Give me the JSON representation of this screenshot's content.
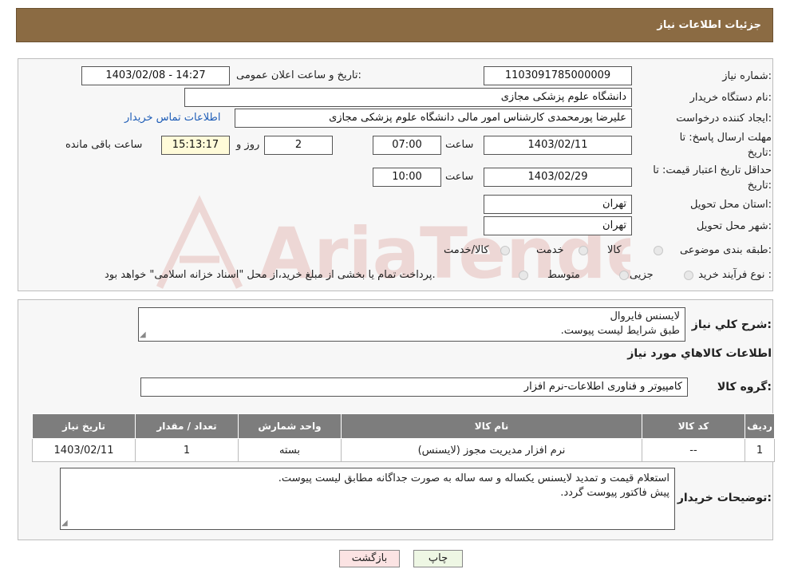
{
  "header": {
    "title": "جزئیات اطلاعات نیاز"
  },
  "form": {
    "need_number_label": "شماره نیاز:",
    "need_number": "1103091785000009",
    "announce_label": "تاریخ و ساعت اعلان عمومی:",
    "announce_value": "1403/02/08 - 14:27",
    "buyer_org_label": "نام دستگاه خریدار:",
    "buyer_org": "دانشگاه علوم پزشکی مجازی",
    "creator_label": "ایجاد کننده درخواست:",
    "creator": "علیرضا پورمحمدی کارشناس امور مالی دانشگاه علوم پزشکی مجازی",
    "contact_link": "اطلاعات تماس خریدار",
    "deadline_label_1": "مهلت ارسال پاسخ: تا",
    "deadline_label_2": "تاریخ:",
    "deadline_date": "1403/02/11",
    "time_label": "ساعت",
    "deadline_time": "07:00",
    "days": "2",
    "days_label": "روز و",
    "remaining_time": "15:13:17",
    "remaining_label": "ساعت باقی مانده",
    "validity_label_1": "حداقل تاریخ اعتبار قیمت: تا",
    "validity_label_2": "تاریخ:",
    "validity_date": "1403/02/29",
    "validity_time": "10:00",
    "province_label": "استان محل تحویل:",
    "province": "تهران",
    "city_label": "شهر محل تحویل:",
    "city": "تهران",
    "category_label": "طبقه بندی موضوعی:",
    "category_options": [
      "کالا",
      "خدمت",
      "کالا/خدمت"
    ],
    "process_label": "نوع فرآیند خرید :",
    "process_options": [
      "جزیی",
      "متوسط"
    ],
    "process_note": "پرداخت تمام یا بخشی از مبلغ خرید،از محل \"اسناد خزانه اسلامی\" خواهد بود."
  },
  "details": {
    "summary_label": "شرح کلي نياز:",
    "summary_lines": [
      "لایسنس فایروال",
      "طبق شرایط لیست پیوست."
    ],
    "goods_info_title": "اطلاعات کالاهاي مورد نياز",
    "goods_group_label": "گروه کالا:",
    "goods_group": "کامپیوتر و فناوری اطلاعات-نرم افزار",
    "table": {
      "headers": [
        "رديف",
        "کد کالا",
        "نام کالا",
        "واحد شمارش",
        "تعداد / مقدار",
        "تاريخ نياز"
      ],
      "rows": [
        [
          "1",
          "--",
          "نرم افزار مدیریت مجوز (لایسنس)",
          "بسته",
          "1",
          "1403/02/11"
        ]
      ]
    },
    "buyer_notes_label": "توضيحات خريدار:",
    "buyer_notes_lines": [
      "استعلام قیمت و تمدید لایسنس یکساله و سه ساله به صورت جداگانه مطابق لیست پیوست.",
      "پیش فاکتور پیوست گردد."
    ]
  },
  "buttons": {
    "print": "چاپ",
    "back": "بازگشت"
  },
  "watermark": {
    "text": "AriaTender.neT"
  },
  "colors": {
    "header_bg": "#8b6b43",
    "link": "#1e5db7",
    "table_header": "#7d7d7d"
  }
}
